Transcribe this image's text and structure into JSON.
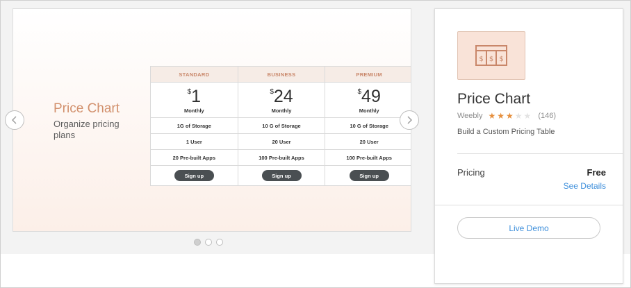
{
  "slide": {
    "title": "Price Chart",
    "subtitle": "Organize pricing plans",
    "plans": [
      {
        "name": "STANDARD",
        "currency": "$",
        "amount": "1",
        "period": "Monthly",
        "features": [
          "1G of Storage",
          "1 User",
          "20 Pre-built Apps"
        ],
        "cta": "Sign up"
      },
      {
        "name": "BUSINESS",
        "currency": "$",
        "amount": "24",
        "period": "Monthly",
        "features": [
          "10 G of Storage",
          "20 User",
          "100 Pre-built Apps"
        ],
        "cta": "Sign up"
      },
      {
        "name": "PREMIUM",
        "currency": "$",
        "amount": "49",
        "period": "Monthly",
        "features": [
          "10 G of Storage",
          "20 User",
          "100 Pre-built Apps"
        ],
        "cta": "Sign up"
      }
    ],
    "prev_icon": "chevron-left-icon",
    "next_icon": "chevron-right-icon",
    "dot_count": 3,
    "active_dot": 1
  },
  "app": {
    "name": "Price Chart",
    "developer": "Weebly",
    "rating": 3,
    "rating_max": 5,
    "reviews": "(146)",
    "description": "Build a Custom Pricing Table",
    "pricing_label": "Pricing",
    "pricing_value": "Free",
    "see_details": "See Details",
    "demo_label": "Live Demo",
    "icon": "price-table-icon"
  },
  "colors": {
    "accent": "#d2906d",
    "link": "#3e8fdb",
    "star": "#e68f3d",
    "button_dark": "#4a4f52"
  }
}
